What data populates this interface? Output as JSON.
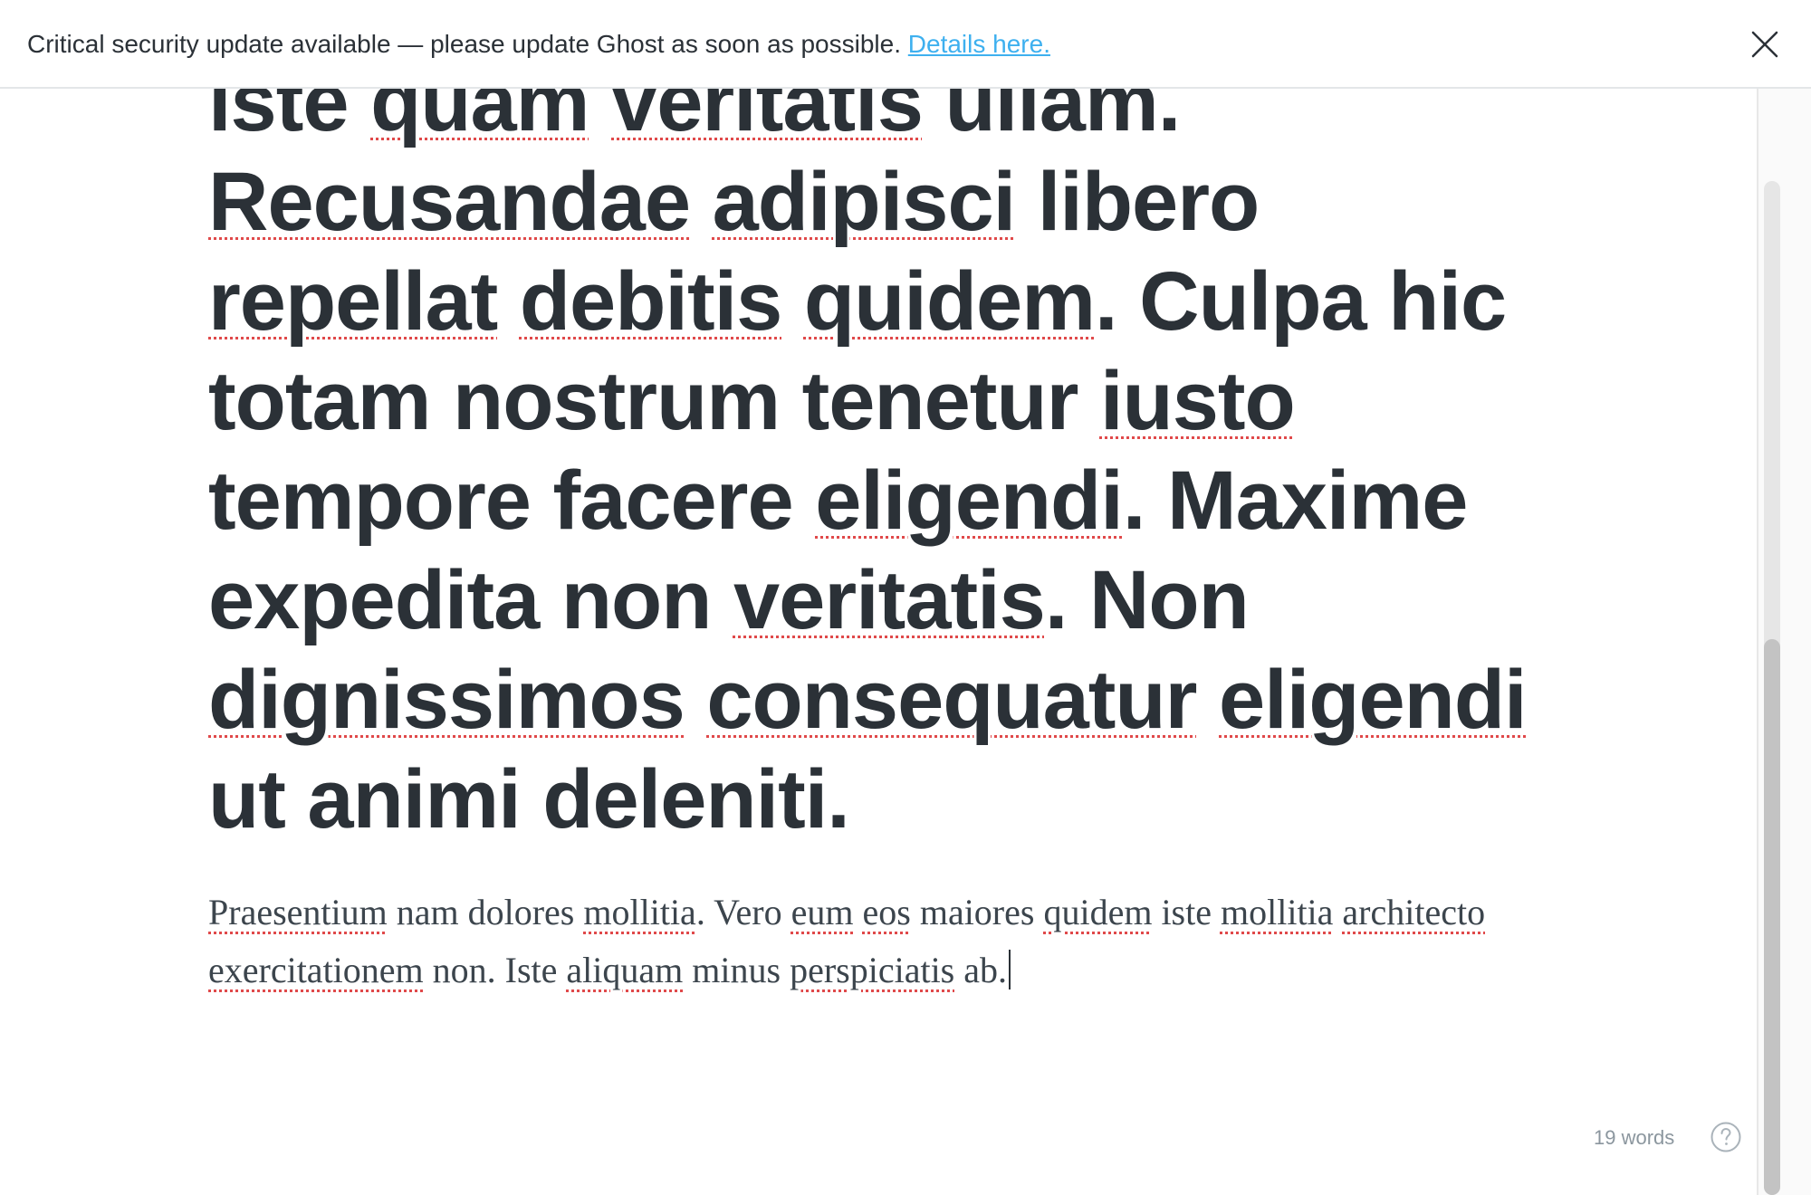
{
  "alert": {
    "message": "Critical security update available — please update Ghost as soon as possible.",
    "link_label": "Details here.",
    "close_icon": "close-icon",
    "link_color": "#3eb0ef"
  },
  "editor": {
    "title_words": [
      {
        "t": "iste",
        "sp": false
      },
      {
        "t": "quam",
        "sp": true
      },
      {
        "t": "veritatis",
        "sp": true
      },
      {
        "t": "ullam.",
        "sp": false
      },
      {
        "t": "Recusandae",
        "sp": true
      },
      {
        "t": "adipisci",
        "sp": true
      },
      {
        "t": "libero",
        "sp": false
      },
      {
        "t": "repellat",
        "sp": true
      },
      {
        "t": "debitis",
        "sp": true
      },
      {
        "t": "quidem",
        "sp": true,
        "after": "."
      },
      {
        "t": "Culpa",
        "sp": false
      },
      {
        "t": "hic",
        "sp": false
      },
      {
        "t": "totam",
        "sp": false
      },
      {
        "t": "nostrum",
        "sp": false
      },
      {
        "t": "tenetur",
        "sp": false
      },
      {
        "t": "iusto",
        "sp": true
      },
      {
        "t": "tempore",
        "sp": false
      },
      {
        "t": "facere",
        "sp": false
      },
      {
        "t": "eligendi",
        "sp": true,
        "after": "."
      },
      {
        "t": "Maxime",
        "sp": false
      },
      {
        "t": "expedita",
        "sp": false
      },
      {
        "t": "non",
        "sp": false
      },
      {
        "t": "veritatis",
        "sp": true,
        "after": "."
      },
      {
        "t": "Non",
        "sp": false
      },
      {
        "t": "dignissimos",
        "sp": true
      },
      {
        "t": "consequatur",
        "sp": true
      },
      {
        "t": "eligendi",
        "sp": true
      },
      {
        "t": "ut",
        "sp": false
      },
      {
        "t": "animi",
        "sp": false
      },
      {
        "t": "deleniti.",
        "sp": false
      }
    ],
    "body_words": [
      {
        "t": "Praesentium",
        "sp": true
      },
      {
        "t": "nam",
        "sp": false
      },
      {
        "t": "dolores",
        "sp": false
      },
      {
        "t": "mollitia",
        "sp": true,
        "after": "."
      },
      {
        "t": "Vero",
        "sp": false
      },
      {
        "t": "eum",
        "sp": true
      },
      {
        "t": "eos",
        "sp": true
      },
      {
        "t": "maiores",
        "sp": false
      },
      {
        "t": "quidem",
        "sp": true
      },
      {
        "t": "iste",
        "sp": false
      },
      {
        "t": "mollitia",
        "sp": true
      },
      {
        "t": "architecto",
        "sp": true
      },
      {
        "t": "exercitationem",
        "sp": true
      },
      {
        "t": "non.",
        "sp": false
      },
      {
        "t": "Iste",
        "sp": false
      },
      {
        "t": "aliquam",
        "sp": true
      },
      {
        "t": "minus",
        "sp": false
      },
      {
        "t": "perspiciatis",
        "sp": true
      },
      {
        "t": "ab.",
        "sp": false
      }
    ]
  },
  "footer": {
    "word_count": "19 words",
    "help_icon": "help-circle-icon"
  }
}
